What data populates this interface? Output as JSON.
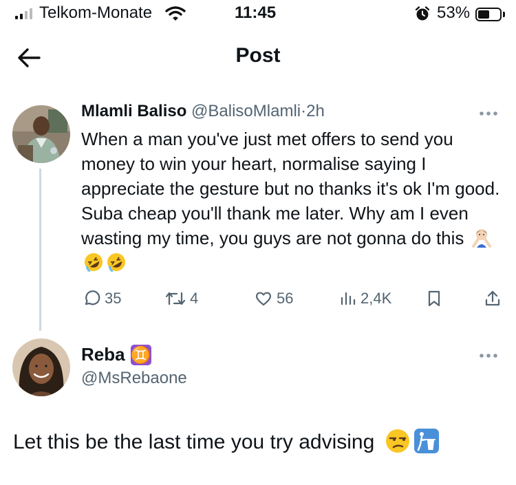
{
  "status_bar": {
    "carrier": "Telkom-Monate",
    "time": "11:45",
    "battery_percent": "53%",
    "battery_level": 0.53,
    "signal_bars_active": 2,
    "icons": [
      "signal-icon",
      "wifi-icon",
      "alarm-icon",
      "battery-icon"
    ]
  },
  "header": {
    "title": "Post",
    "back_icon": "arrow-left-icon"
  },
  "tweet": {
    "author_name": "Mlamli Baliso",
    "author_handle": "@BalisoMlamli",
    "separator": "·",
    "time_ago": "2h",
    "text": "When a man you've just met offers to send you money to win your heart, normalise saying I appreciate the gesture but no thanks it's ok I'm good. Suba cheap you'll thank me later. Why am I even wasting my time, you guys are not gonna do this",
    "emojis": [
      "person-gesturing-no-emoji",
      "rolling-on-floor-laughing-emoji",
      "rolling-on-floor-laughing-emoji"
    ],
    "stats": {
      "replies": "35",
      "reposts": "4",
      "likes": "56",
      "views": "2,4K"
    }
  },
  "reply": {
    "author_name": "Reba",
    "badge": "♊",
    "author_handle": "@MsRebaone",
    "text": "Let this be the last time you try advising",
    "emojis": [
      "unamused-face-emoji",
      "put-litter-in-its-place-emoji"
    ]
  },
  "colors": {
    "text": "#0f1419",
    "secondary": "#536471",
    "thread_line": "#cfd9de",
    "gemini_badge": "#8e4fcc"
  }
}
